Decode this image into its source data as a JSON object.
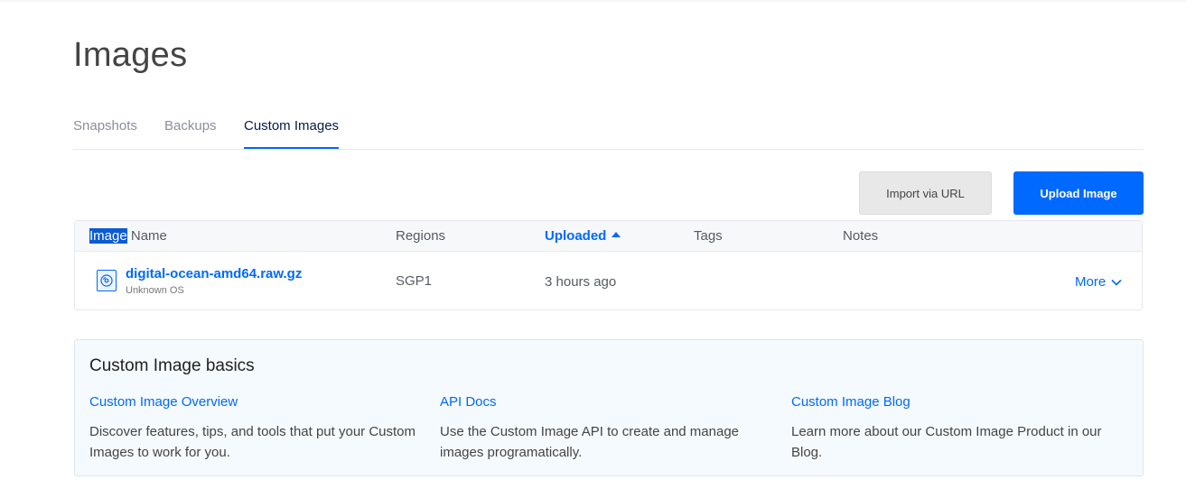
{
  "page": {
    "title": "Images"
  },
  "tabs": [
    {
      "label": "Snapshots"
    },
    {
      "label": "Backups"
    },
    {
      "label": "Custom Images"
    }
  ],
  "toolbar": {
    "import_label": "Import via URL",
    "upload_label": "Upload Image"
  },
  "table": {
    "columns": {
      "name_highlight": "Image",
      "name_rest": " Name",
      "regions": "Regions",
      "uploaded": "Uploaded",
      "tags": "Tags",
      "notes": "Notes"
    },
    "rows": [
      {
        "name": "digital-ocean-amd64.raw.gz",
        "os": "Unknown OS",
        "region": "SGP1",
        "uploaded": "3 hours ago",
        "tags": "",
        "notes": "",
        "action": "More"
      }
    ]
  },
  "basics": {
    "title": "Custom Image basics",
    "columns": [
      {
        "link": "Custom Image Overview",
        "desc": "Discover features, tips, and tools that put your Custom Images to work for you."
      },
      {
        "link": "API Docs",
        "desc": "Use the Custom Image API to create and manage images programatically."
      },
      {
        "link": "Custom Image Blog",
        "desc": "Learn more about our Custom Image Product in our Blog."
      }
    ]
  },
  "colors": {
    "accent": "#0069ff",
    "title": "#444444",
    "panel_bg": "#f5fafe"
  },
  "icons": {
    "os": "unknown-os-icon",
    "sort": "sort-ascending-icon",
    "more": "chevron-down-icon"
  }
}
